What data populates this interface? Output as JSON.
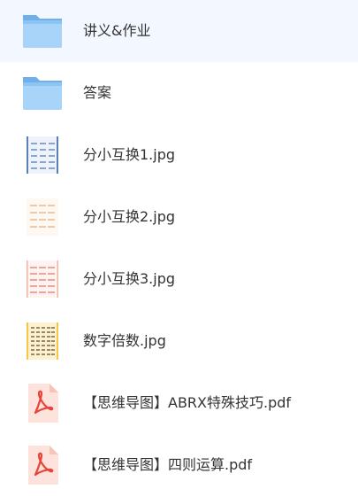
{
  "files": [
    {
      "name": "讲义&作业",
      "icon": "folder-icon"
    },
    {
      "name": "答案",
      "icon": "folder-icon"
    },
    {
      "name": "分小互换1.jpg",
      "icon": "image-file-icon"
    },
    {
      "name": "分小互换2.jpg",
      "icon": "image-file-icon"
    },
    {
      "name": "分小互换3.jpg",
      "icon": "image-file-icon"
    },
    {
      "name": "数字倍数.jpg",
      "icon": "image-file-icon"
    },
    {
      "name": "【思维导图】ABRX特殊技巧.pdf",
      "icon": "pdf-file-icon"
    },
    {
      "name": "【思维导图】四则运算.pdf",
      "icon": "pdf-file-icon"
    }
  ],
  "colors": {
    "folder": "#8cc4f4",
    "folder_tab": "#6fb0ea",
    "pdf_bg": "#fde3dc",
    "pdf_accent": "#e8443a",
    "text": "#333333"
  }
}
